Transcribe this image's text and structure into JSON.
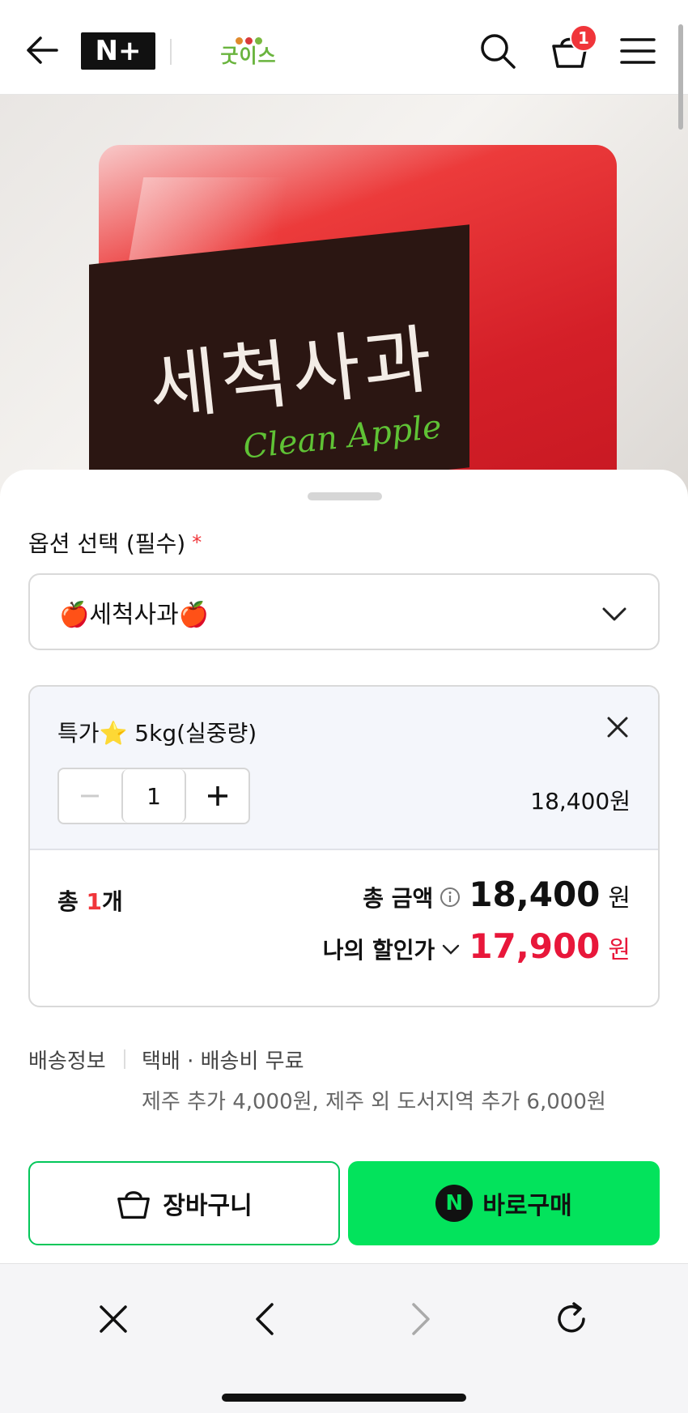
{
  "header": {
    "back_icon": "arrow-left-icon",
    "nplus_logo": "N+",
    "brand": {
      "name": "굿이스",
      "dot_colors": [
        "#e08a2c",
        "#d93a3a",
        "#7ab83f"
      ]
    },
    "cart_count": "1",
    "accent_badge_color": "#f0353a"
  },
  "product_image": {
    "title": "세척사과",
    "subtitle": "Clean Apple"
  },
  "sheet": {
    "option_label": "옵션 선택 (필수)",
    "required_mark": "*",
    "selected_option": "🍎세척사과🍎",
    "option_item": {
      "name": "특가⭐ 5kg(실중량)",
      "quantity": "1",
      "price": "18,400원"
    },
    "total": {
      "prefix": "총 ",
      "count": "1",
      "suffix": "개",
      "amount_label": "총 금액",
      "amount_value": "18,400",
      "amount_unit": "원",
      "discount_label": "나의 할인가",
      "discount_value": "17,900",
      "discount_unit": "원"
    },
    "shipping": {
      "label": "배송정보",
      "value": "택배 · 배송비 무료",
      "note": "제주 추가 4,000원, 제주 외 도서지역 추가 6,000원"
    },
    "buttons": {
      "cart": "장바구니",
      "buy_badge": "N",
      "buy": "바로구매"
    },
    "colors": {
      "buy_green": "#03e35c",
      "cart_border": "#03c75a",
      "discount_red": "#e8173a"
    }
  },
  "browser_bar": {
    "icons": [
      "close-icon",
      "back-chevron-icon",
      "forward-chevron-icon",
      "reload-icon"
    ]
  }
}
